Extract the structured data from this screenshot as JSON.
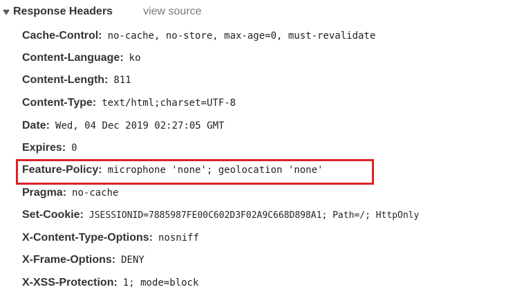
{
  "section": {
    "title": "Response Headers",
    "toggle_icon": "triangle-down-icon",
    "view_source_label": "view source"
  },
  "headers": [
    {
      "name": "Cache-Control:",
      "value": "no-cache, no-store, max-age=0, must-revalidate"
    },
    {
      "name": "Content-Language:",
      "value": "ko"
    },
    {
      "name": "Content-Length:",
      "value": "811"
    },
    {
      "name": "Content-Type:",
      "value": "text/html;charset=UTF-8"
    },
    {
      "name": "Date:",
      "value": "Wed, 04 Dec 2019 02:27:05 GMT"
    },
    {
      "name": "Expires:",
      "value": "0"
    },
    {
      "name": "Feature-Policy:",
      "value": "microphone 'none'; geolocation 'none'"
    },
    {
      "name": "Pragma:",
      "value": "no-cache"
    },
    {
      "name": "Set-Cookie:",
      "value": "JSESSIONID=7885987FE00C602D3F02A9C668D898A1; Path=/; HttpOnly"
    },
    {
      "name": "X-Content-Type-Options:",
      "value": "nosniff"
    },
    {
      "name": "X-Frame-Options:",
      "value": "DENY"
    },
    {
      "name": "X-XSS-Protection:",
      "value": "1; mode=block"
    }
  ],
  "highlight": {
    "color": "#dd1f26",
    "target_header": "Feature-Policy:"
  }
}
